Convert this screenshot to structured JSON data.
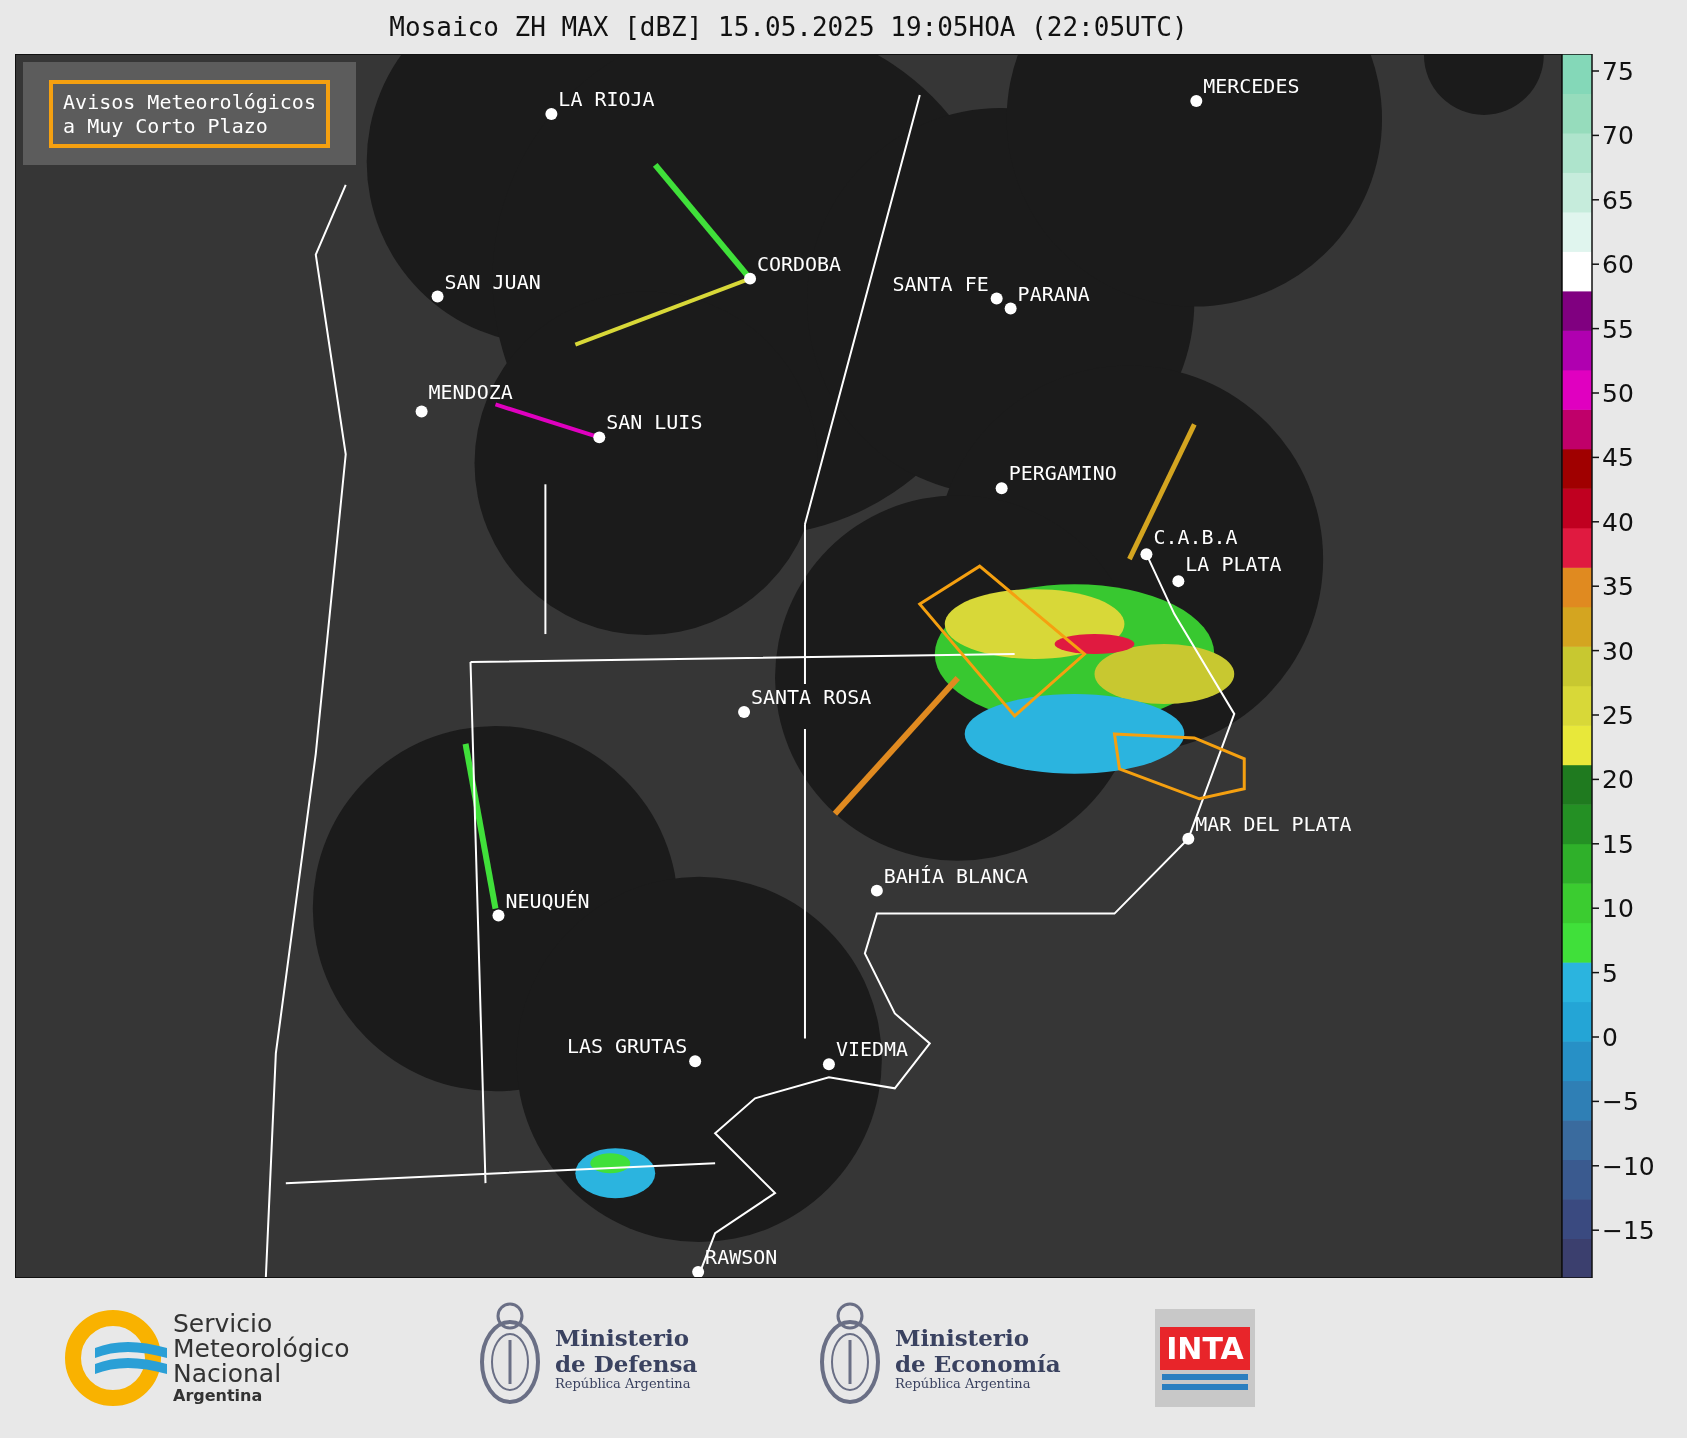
{
  "title": "Mosaico ZH MAX [dBZ] 15.05.2025 19:05HOA (22:05UTC)",
  "legend_box": {
    "text": "Avisos Meteorológicos\na Muy Corto Plazo"
  },
  "cities": [
    {
      "name": "LA RIOJA"
    },
    {
      "name": "CORDOBA"
    },
    {
      "name": "SAN JUAN"
    },
    {
      "name": "SANTA FE"
    },
    {
      "name": "PARANA"
    },
    {
      "name": "MENDOZA"
    },
    {
      "name": "SAN LUIS"
    },
    {
      "name": "MERCEDES"
    },
    {
      "name": "PERGAMINO"
    },
    {
      "name": "C.A.B.A"
    },
    {
      "name": "LA PLATA"
    },
    {
      "name": "SANTA ROSA"
    },
    {
      "name": "MAR DEL PLATA"
    },
    {
      "name": "BAHÍA BLANCA"
    },
    {
      "name": "NEUQUÉN"
    },
    {
      "name": "LAS GRUTAS"
    },
    {
      "name": "VIEDMA"
    },
    {
      "name": "RAWSON"
    }
  ],
  "colorbar": {
    "ticks": [
      "75",
      "70",
      "65",
      "60",
      "55",
      "50",
      "45",
      "40",
      "35",
      "30",
      "25",
      "20",
      "15",
      "10",
      "5",
      "0",
      "−5",
      "−10",
      "−15"
    ]
  },
  "footer": {
    "logos": [
      {
        "kind": "smn",
        "lines": [
          "Servicio",
          "Meteorológico",
          "Nacional"
        ],
        "sub": "Argentina"
      },
      {
        "kind": "ministry",
        "lines": [
          "Ministerio",
          "de Defensa"
        ],
        "sub": "República Argentina"
      },
      {
        "kind": "ministry",
        "lines": [
          "Ministerio",
          "de Economía"
        ],
        "sub": "República Argentina"
      },
      {
        "kind": "inta",
        "lines": [
          "INTA"
        ]
      }
    ]
  }
}
